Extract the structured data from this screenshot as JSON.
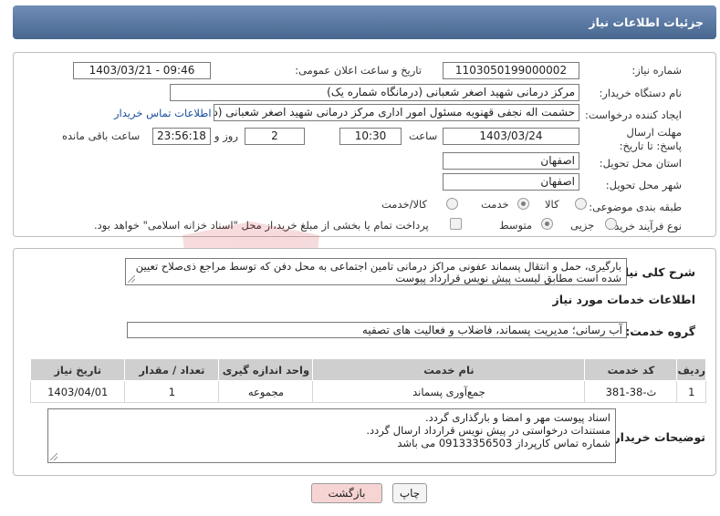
{
  "header": {
    "title": "جزئیات اطلاعات نیاز"
  },
  "fields": {
    "need_number_label": "شماره نیاز:",
    "need_number": "1103050199000002",
    "announce_label": "تاریخ و ساعت اعلان عمومی:",
    "announce_value": "1403/03/21 - 09:46",
    "buyer_label": "نام دستگاه خریدار:",
    "buyer_value": "مرکز درمانی شهید اصغر شعبانی (درمانگاه شماره یک)",
    "creator_label": "ایجاد کننده درخواست:",
    "creator_value": "حشمت اله نجفی قهنویه مسئول امور اداری مرکز درمانی شهید اصغر شعبانی (د",
    "contact_link": "اطلاعات تماس خریدار",
    "deadline_label": "مهلت ارسال پاسخ: تا تاریخ:",
    "deadline_date": "1403/03/24",
    "time_label": "ساعت",
    "deadline_time": "10:30",
    "days_value": "2",
    "days_label": "روز و",
    "remaining_value": "23:56:18",
    "remaining_label": "ساعت باقی مانده",
    "province_label": "استان محل تحویل:",
    "province_value": "اصفهان",
    "city_label": "شهر محل تحویل:",
    "city_value": "اصفهان",
    "category_label": "طبقه بندی موضوعی:",
    "category_options": [
      "کالا",
      "خدمت",
      "کالا/خدمت"
    ],
    "process_label": "نوع فرآیند خرید :",
    "process_options": [
      "جزیی",
      "متوسط"
    ],
    "payment_note": "پرداخت تمام یا بخشی از مبلغ خرید،از محل \"اسناد خزانه اسلامی\" خواهد بود."
  },
  "summary": {
    "label": "شرح کلی نیاز:",
    "text": "بارگیری، حمل و انتقال پسماند عفونی مراکز درمانی تامین اجتماعی به محل دفن که توسط مراجع ذی‌صلاح تعیین شده است مطابق لیست  پیش نویس قرارداد پیوست"
  },
  "services": {
    "section_title": "اطلاعات خدمات مورد نیاز",
    "group_label": "گروه خدمت:",
    "group_value": "آب رسانی؛ مدیریت پسماند، فاضلاب و فعالیت های تصفیه",
    "columns": [
      "ردیف",
      "کد خدمت",
      "نام خدمت",
      "واحد اندازه گیری",
      "تعداد / مقدار",
      "تاریخ نیاز"
    ],
    "rows": [
      [
        "1",
        "ث-38-381",
        "جمع‌آوری پسماند",
        "مجموعه",
        "1",
        "1403/04/01"
      ]
    ]
  },
  "notes": {
    "label": "توضیحات خریدار:",
    "lines": [
      "اسناد پیوست مهر و امضا و بارگذاری گردد.",
      "مستندات درخواستی در پیش نویس قرارداد ارسال گردد.",
      "شماره تماس کارپرداز 09133356503 می باشد"
    ]
  },
  "buttons": {
    "print": "چاپ",
    "back": "بازگشت"
  },
  "colors": {
    "header": "#5a78a3",
    "back_bg": "#f7d4d4",
    "print_bg": "#f4f4f4"
  }
}
